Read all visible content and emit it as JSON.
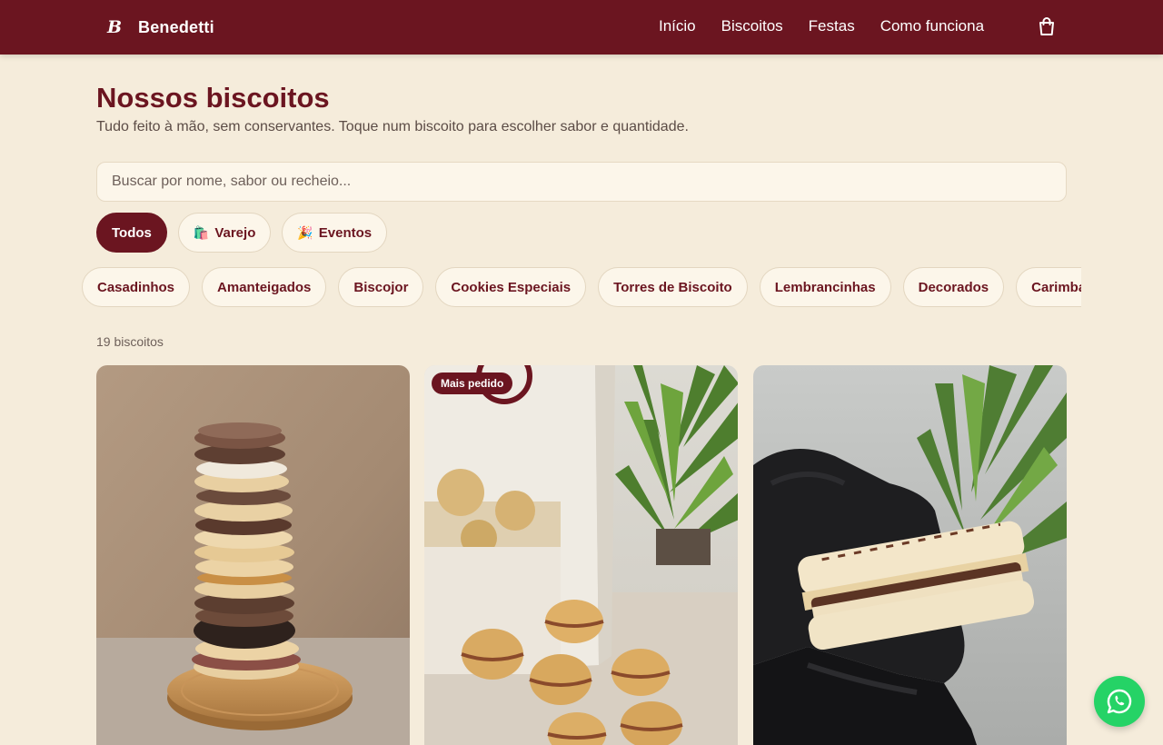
{
  "header": {
    "logo_letter": "B",
    "brand": "Benedetti",
    "nav": [
      {
        "label": "Início"
      },
      {
        "label": "Biscoitos"
      },
      {
        "label": "Festas"
      },
      {
        "label": "Como funciona"
      }
    ],
    "cart_icon": "shopping-bag-icon",
    "bg_color": "#6b1520"
  },
  "main": {
    "title": "Nossos biscoitos",
    "subtitle": "Tudo feito à mão, sem conservantes. Toque num biscoito para escolher sabor e quantidade.",
    "search": {
      "placeholder": "Buscar por nome, sabor ou recheio...",
      "value": ""
    },
    "segments": [
      {
        "label": "Todos",
        "emoji": "",
        "active": true
      },
      {
        "label": "Varejo",
        "emoji": "🛍️",
        "active": false
      },
      {
        "label": "Eventos",
        "emoji": "🎉",
        "active": false
      }
    ],
    "categories": [
      "Casadinhos",
      "Amanteigados",
      "Biscojor",
      "Cookies Especiais",
      "Torres de Biscoito",
      "Lembrancinhas",
      "Decorados",
      "Carimbados"
    ],
    "result_count": "19 biscoitos",
    "products": [
      {
        "badge": "",
        "image": "stacked-sandwich-cookies-photo"
      },
      {
        "badge": "Mais pedido",
        "image": "casadinho-cookies-bag-photo"
      },
      {
        "badge": "",
        "image": "filled-cookie-gloved-hand-photo"
      }
    ]
  },
  "whatsapp": {
    "icon": "whatsapp-icon",
    "color": "#25d366"
  },
  "colors": {
    "brand": "#6b1520",
    "background": "#f5ecdb",
    "surface": "#fcf6ea"
  }
}
